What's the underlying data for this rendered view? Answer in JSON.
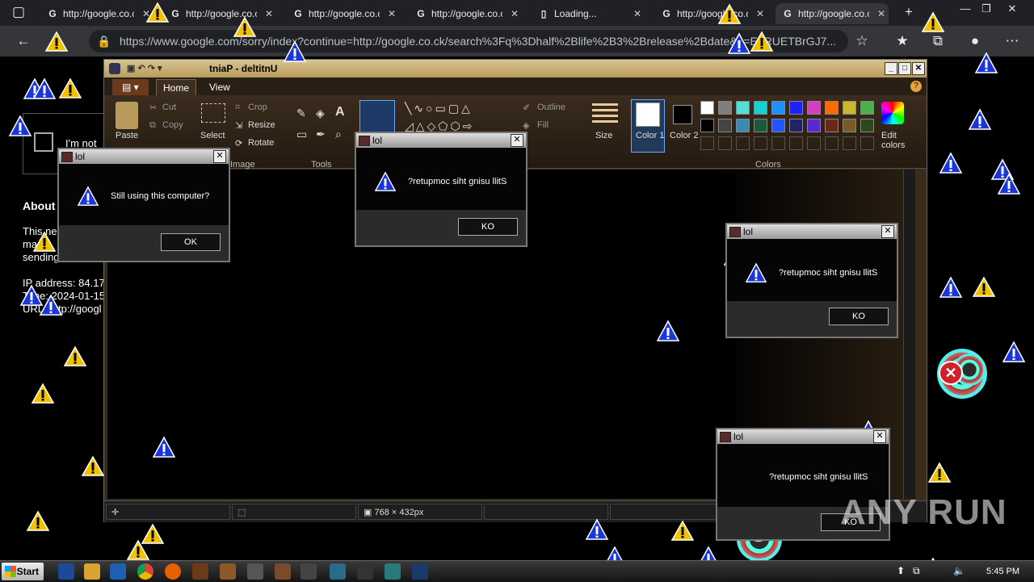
{
  "browser": {
    "tabs": [
      {
        "title": "http://google.co.ck",
        "active": false
      },
      {
        "title": "http://google.co.ck",
        "active": false
      },
      {
        "title": "http://google.co.ck",
        "active": false
      },
      {
        "title": "http://google.co.ck",
        "active": false
      },
      {
        "title": "Loading...",
        "active": false
      },
      {
        "title": "http://google.co.ck",
        "active": false
      },
      {
        "title": "http://google.co.ck",
        "active": true
      }
    ],
    "new_tab_label": "+",
    "url": "https://www.google.com/sorry/index?continue=http://google.co.ck/search%3Fq%3Dhalf%2Blife%2B3%2Brelease%2Bdate&q=EgRUETBrGJ7..."
  },
  "google_page": {
    "captcha_label": "I'm not",
    "about_heading": "About",
    "body_lines": [
      "This ne",
      "ma",
      "sending"
    ],
    "ip_line": "IP address: 84.17",
    "time_line": "Time: 2024-01-15",
    "url_line": "URL: http://googl"
  },
  "paint": {
    "title": "tniaP - deltitnU",
    "tabs": {
      "home": "Home",
      "view": "View"
    },
    "clipboard": {
      "paste": "Paste",
      "cut": "Cut",
      "copy": "Copy"
    },
    "image": {
      "select": "Select",
      "crop": "Crop",
      "resize": "Resize",
      "rotate": "Rotate",
      "group": "Image"
    },
    "tools_group": "Tools",
    "shapes": {
      "outline": "Outline",
      "fill": "Fill"
    },
    "size_label": "Size",
    "color1": "Color 1",
    "color2": "Color 2",
    "colors_group": "Colors",
    "edit_colors": "Edit colors",
    "palette": [
      "#ffffff",
      "#7f7f7f",
      "#55ddd6",
      "#17d1d1",
      "#1e90ff",
      "#2020ff",
      "#d040c0",
      "#ff6a00",
      "#c8b830",
      "#4caf50",
      "#000000",
      "#444444",
      "#3b8ab0",
      "#1a5a3a",
      "#2255ff",
      "#222266",
      "#5a2ad0",
      "#6a2a1a",
      "#7a5a2a",
      "#2a4a1a"
    ],
    "status": {
      "dimensions": "768 × 432px"
    }
  },
  "dialogs": [
    {
      "title": "lol",
      "message": "Still using this computer?",
      "button": "OK"
    },
    {
      "title": "lol",
      "message": "?retupmoc siht gnisu llitS",
      "button": "KO"
    },
    {
      "title": "lol",
      "message": "?retupmoc siht gnisu llitS",
      "button": "KO"
    },
    {
      "title": "lol",
      "message": "?retupmoc siht gnisu llitS",
      "button": "KO"
    }
  ],
  "taskbar": {
    "start_label": "Start",
    "clock": "5:45 PM"
  },
  "watermark": "ANY RUN"
}
